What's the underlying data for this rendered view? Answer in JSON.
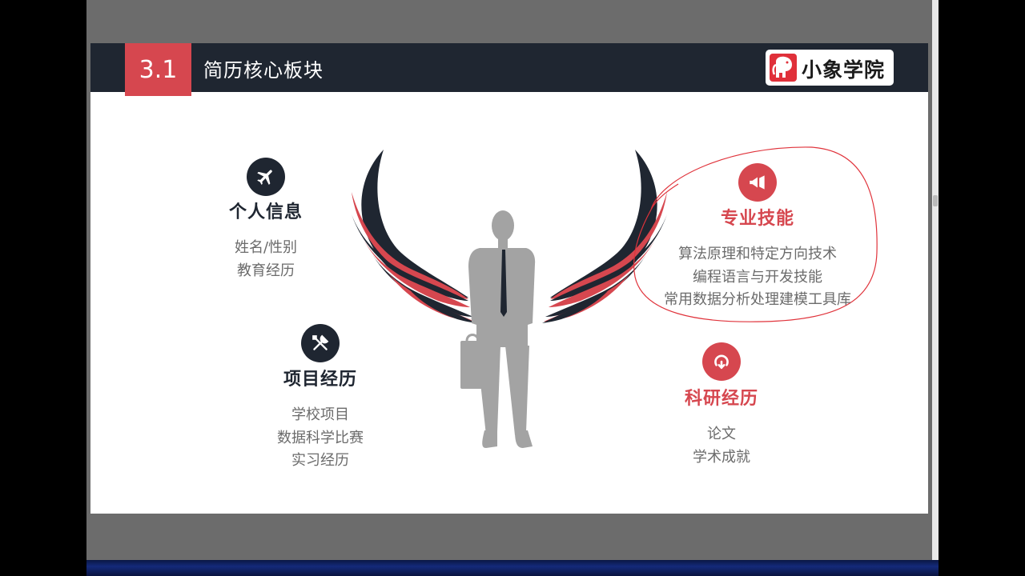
{
  "slide": {
    "number": "3.1",
    "title": "简历核心板块",
    "logo_text": "小象学院"
  },
  "sections": {
    "personal": {
      "heading": "个人信息",
      "items": [
        "姓名/性别",
        "教育经历"
      ],
      "icon": "airplane-icon"
    },
    "projects": {
      "heading": "项目经历",
      "items": [
        "学校项目",
        "数据科学比赛",
        "实习经历"
      ],
      "icon": "tools-icon"
    },
    "skills": {
      "heading": "专业技能",
      "items": [
        "算法原理和特定方向技术",
        "编程语言与开发技能",
        "常用数据分析处理建模工具库"
      ],
      "icon": "megaphone-icon"
    },
    "research": {
      "heading": "科研经历",
      "items": [
        "论文",
        "学术成就"
      ],
      "icon": "refresh-icon"
    }
  },
  "colors": {
    "accent": "#d6474f",
    "dark": "#1f2631",
    "annotation": "#e0333b"
  }
}
